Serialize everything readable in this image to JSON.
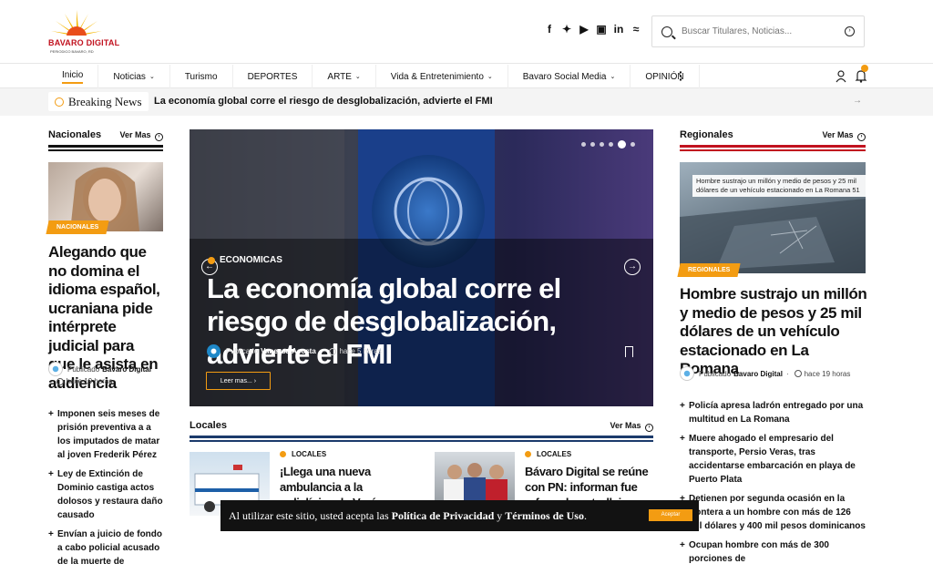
{
  "brand": {
    "name": "BAVARO DIGITAL",
    "tagline": "PERIODICO BAVARO, RD"
  },
  "search": {
    "placeholder": "Buscar Titulares, Noticias..."
  },
  "social_icons": [
    "facebook-icon",
    "twitter-icon",
    "youtube-icon",
    "instagram-icon",
    "linkedin-icon",
    "rss-icon"
  ],
  "social_glyphs": [
    "f",
    "✦",
    "▶",
    "▣",
    "in",
    "≈"
  ],
  "nav": {
    "items": [
      {
        "label": "Inicio",
        "active": true
      },
      {
        "label": "Noticias",
        "dropdown": true
      },
      {
        "label": "Turismo"
      },
      {
        "label": "DEPORTES"
      },
      {
        "label": "ARTE",
        "dropdown": true
      },
      {
        "label": "Vida & Entretenimiento",
        "dropdown": true
      },
      {
        "label": "Bavaro Social Media",
        "dropdown": true
      },
      {
        "label": "OPINIÓN"
      }
    ],
    "chevron": "⌄"
  },
  "breaking": {
    "label": "Breaking News",
    "text": "La economía global corre el riesgo de desglobalización, advierte el FMI",
    "arrow": "→"
  },
  "nacionales": {
    "title": "Nacionales",
    "ver_mas": "Ver Mas",
    "arrow": "›",
    "badge": "NACIONALES",
    "headline": "Alegando que no domina el idioma español, ucraniana pide intérprete judicial para que le asista en audiencia",
    "author_prefix": "Publicado",
    "author": "Bavaro Digital",
    "time": "hace 19 horas",
    "list": [
      "Imponen seis meses de prisión preventiva a a los imputados de matar al joven Frederik Pérez",
      "Ley de Extinción de Dominio castiga actos dolosos y restaura daño causado",
      "Envían a juicio de fondo a cabo policial acusado de la muerte de"
    ]
  },
  "hero": {
    "category": "ECONOMICAS",
    "headline": "La economía global corre el riesgo de desglobalización, advierte el FMI",
    "author_prefix": "Publicado",
    "author": "Vanessa Acosta",
    "time": "hace 5 horas",
    "button": "Leer mas...",
    "prev": "←",
    "next": "→",
    "slides": 6,
    "active_slide": 5
  },
  "locales": {
    "title": "Locales",
    "ver_mas": "Ver Mas",
    "arrow": "›",
    "items": [
      {
        "category": "LOCALES",
        "headline": "¡Llega una nueva ambulancia a la policlínica de Verón-Punta Cana!"
      },
      {
        "category": "LOCALES",
        "headline": "Bávaro Digital se reúne con PN: informan fue reforzado patrullaje en Bávaro y Verón"
      }
    ]
  },
  "regionales": {
    "title": "Regionales",
    "ver_mas": "Ver Mas",
    "arrow": "›",
    "badge": "REGIONALES",
    "image_caption": "Hombre sustrajo un millón y medio de pesos y 25 mil dólares de un vehículo estacionado en La Romana 51",
    "headline": "Hombre sustrajo un millón y medio de pesos y 25 mil dólares de un vehículo estacionado en La Romana",
    "author_prefix": "Publicado",
    "author": "Bavaro Digital",
    "time": "hace 19 horas",
    "list": [
      "Policía apresa ladrón entregado por una multitud en La Romana",
      "Muere ahogado el empresario del transporte, Persio Veras, tras accidentarse embarcación en playa de Puerto Plata",
      "Detienen por segunda ocasión en la frontera a un hombre con más de 126 mil dólares y 400 mil pesos dominicanos",
      "Ocupan hombre con más de 300 porciones de"
    ]
  },
  "cookie": {
    "prefix": "Al utilizar este sitio, usted acepta las ",
    "privacy": "Política de Privacidad",
    "y": " y ",
    "terms": "Términos de Uso",
    "suffix": ".",
    "accept": "Aceptar"
  },
  "colors": {
    "accent": "#f39c12",
    "red": "#c1121f",
    "navy": "#1b3a6b"
  }
}
